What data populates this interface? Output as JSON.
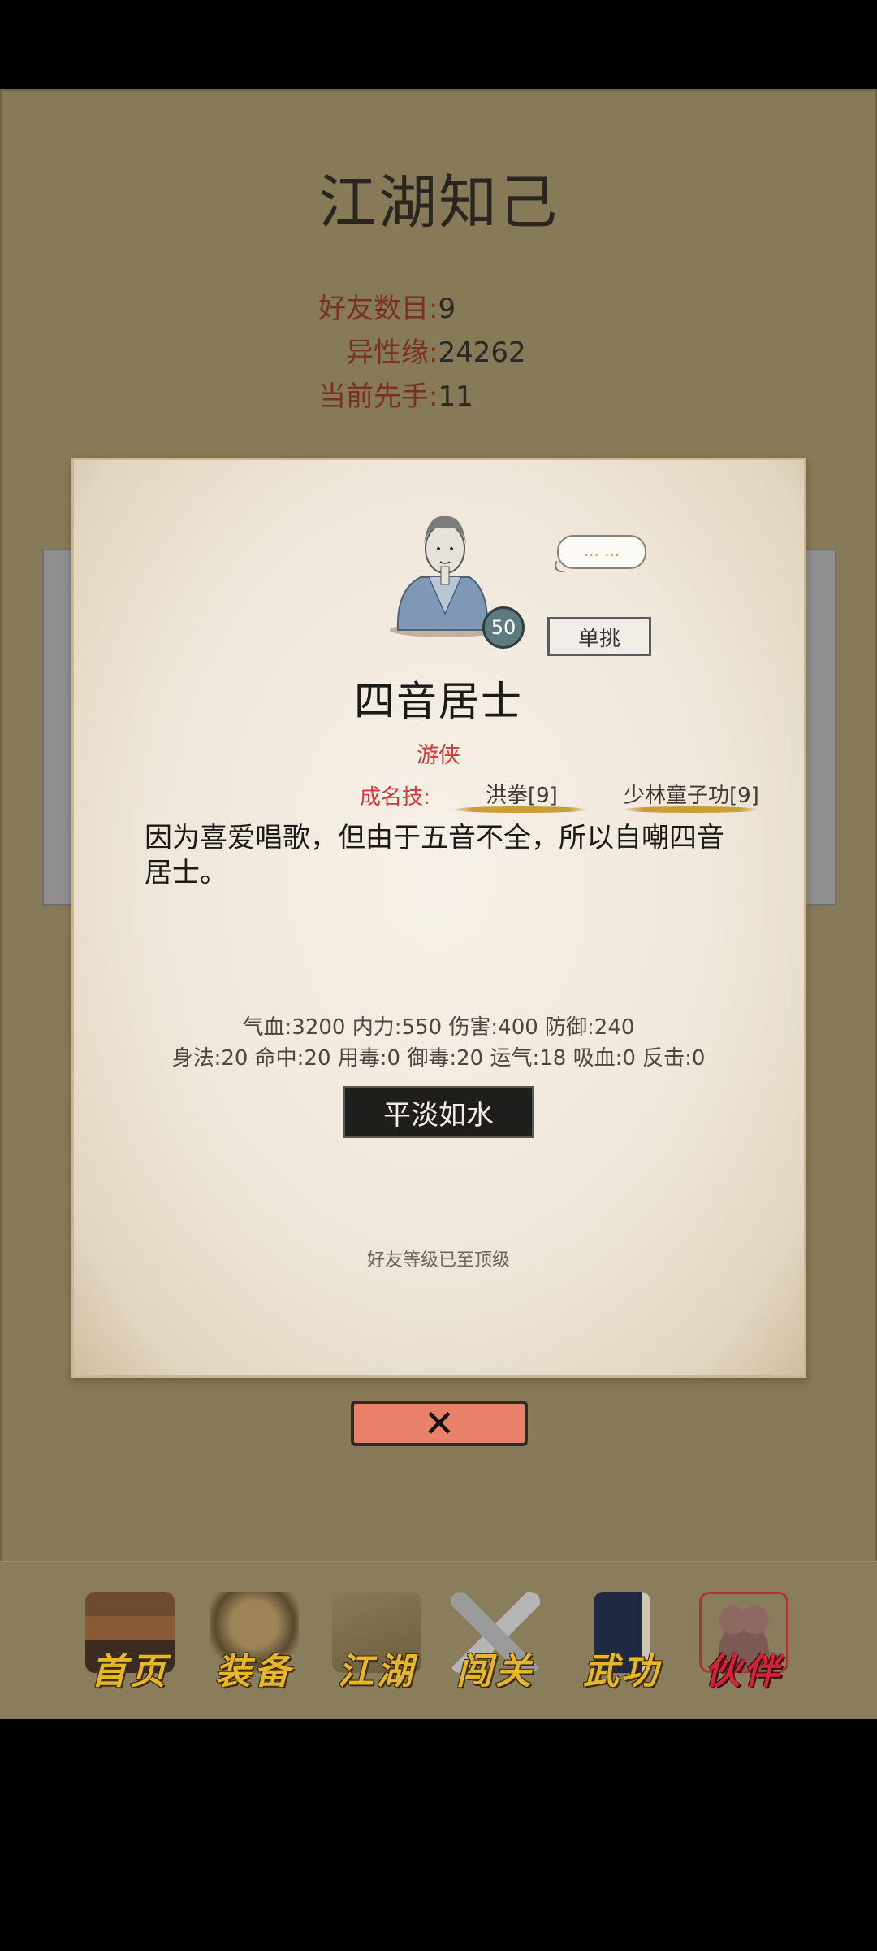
{
  "page": {
    "title": "江湖知己",
    "stats": [
      {
        "label": "好友数目",
        "value": "9"
      },
      {
        "label": "异性缘",
        "value": "24262"
      },
      {
        "label": "当前先手",
        "value": "11"
      }
    ]
  },
  "character": {
    "level": "50",
    "speech": "... ...",
    "duel_label": "单挑",
    "name": "四音居士",
    "class": "游侠",
    "skills_label": "成名技:",
    "skills": [
      "洪拳[9]",
      "少林童子功[9]"
    ],
    "description": "因为喜爱唱歌，但由于五音不全，所以自嘲四音居士。",
    "attributes_line1": "气血:3200  内力:550  伤害:400  防御:240",
    "attributes_line2": "身法:20  命中:20  用毒:0  御毒:20  运气:18  吸血:0  反击:0",
    "mood": "平淡如水",
    "footer_note": "好友等级已至顶级"
  },
  "close": {
    "icon": "close-icon"
  },
  "nav": {
    "items": [
      {
        "label": "首页",
        "icon": "temple-icon"
      },
      {
        "label": "装备",
        "icon": "armor-icon"
      },
      {
        "label": "江湖",
        "icon": "map-scroll-icon"
      },
      {
        "label": "闯关",
        "icon": "crossed-swords-icon"
      },
      {
        "label": "武功",
        "icon": "martial-book-icon"
      },
      {
        "label": "伙伴",
        "icon": "companions-icon"
      }
    ],
    "active": "伙伴"
  },
  "colors": {
    "background": "#877a58",
    "card": "#f0e9dd",
    "accent_red": "#d7363a",
    "nav_gold": "#e6b829",
    "close_button": "#e8806a"
  }
}
